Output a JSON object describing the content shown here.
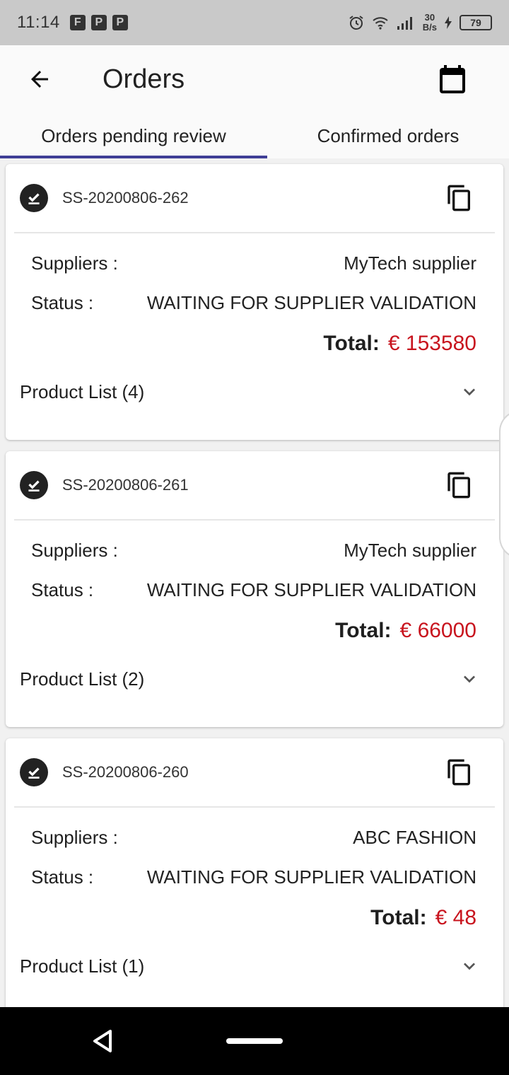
{
  "status_bar": {
    "time": "11:14",
    "app_icons": [
      "F",
      "P",
      "P"
    ],
    "net_speed_value": "30",
    "net_speed_unit": "B/s",
    "battery": "79"
  },
  "app_bar": {
    "title": "Orders",
    "back_icon": "arrow-left-icon",
    "calendar_icon": "calendar-icon"
  },
  "tabs": [
    {
      "label": "Orders pending review",
      "active": true
    },
    {
      "label": "Confirmed orders",
      "active": false
    }
  ],
  "orders": [
    {
      "id": "SS-20200806-262",
      "suppliers_label": "Suppliers :",
      "suppliers": "MyTech supplier",
      "status_label": "Status :",
      "status": "WAITING FOR SUPPLIER VALIDATION",
      "total_label": "Total:",
      "total": "€ 153580",
      "product_list": "Product List (4)"
    },
    {
      "id": "SS-20200806-261",
      "suppliers_label": "Suppliers :",
      "suppliers": "MyTech supplier",
      "status_label": "Status :",
      "status": "WAITING FOR SUPPLIER VALIDATION",
      "total_label": "Total:",
      "total": "€ 66000",
      "product_list": "Product List (2)"
    },
    {
      "id": "SS-20200806-260",
      "suppliers_label": "Suppliers :",
      "suppliers": "ABC FASHION",
      "status_label": "Status :",
      "status": "WAITING FOR SUPPLIER VALIDATION",
      "total_label": "Total:",
      "total": "€ 48",
      "product_list": "Product List (1)"
    }
  ],
  "colors": {
    "accent": "#3f3e96",
    "total_value": "#c8141e"
  }
}
